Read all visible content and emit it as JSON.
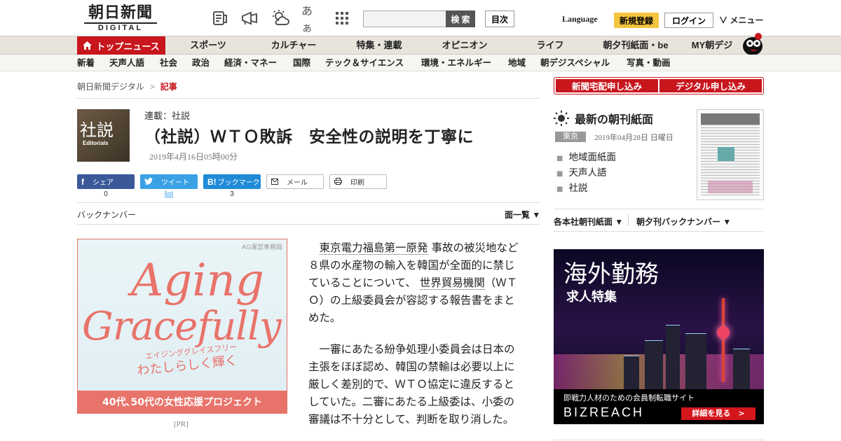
{
  "header": {
    "logo_line1": "朝日新聞",
    "logo_line2": "DIGITAL",
    "icons": [
      "newspaper-icon",
      "megaphone-icon",
      "weather-icon",
      "font-size-icon",
      "apps-grid-icon"
    ],
    "font_icon_text": "あぁ",
    "search_placeholder": "",
    "search_button": "検 索",
    "toc_button": "目次",
    "language": "Language",
    "register": "新規登録",
    "login": "ログイン",
    "menu": "∨ メニュー"
  },
  "nav1": {
    "home": "トップニュース",
    "items": [
      "スポーツ",
      "カルチャー",
      "特集・連載",
      "オピニオン",
      "ライフ",
      "朝夕刊紙面・be",
      "MY朝デジ"
    ]
  },
  "nav2": {
    "items": [
      "新着",
      "天声人語",
      "社会",
      "政治",
      "経済・マネー",
      "国際",
      "テック＆サイエンス",
      "環境・エネルギー",
      "地域",
      "朝デジスペシャル",
      "写真・動画"
    ]
  },
  "breadcrumb": {
    "root": "朝日新聞デジタル",
    "sep": ">",
    "current": "記事"
  },
  "article": {
    "thumb_title": "社説",
    "thumb_sub": "Editorials",
    "series": "連載：社説",
    "title": "（社説）ＷＴＯ敗訴　安全性の説明を丁寧に",
    "date": "2019年4月16日05時00分",
    "share": {
      "facebook_label": "シェア",
      "facebook_count": "0",
      "twitter_label": "ツイート",
      "twitter_count": "list",
      "hatena_label": "ブックマーク",
      "hatena_count": "3",
      "mail_label": "メール",
      "print_label": "印刷"
    },
    "backnumber": "バックナンバー",
    "list_label": "面一覧 ▼",
    "p1_link1": "東京電力福島第一原発",
    "p1_text1": " 事故の被災地など８県の水産物の輸入を韓国が全面的に禁じていることについて、 ",
    "p1_link2": "世界貿易機関",
    "p1_text2": "（ＷＴＯ）の上級委員会が容認する報告書をまとめた。",
    "p2": "一審にあたる紛争処理小委員会は日本の主張をほぼ認め、韓国の禁輸は必要以上に厳しく差別的で、ＷＴＯ協定に違反するとしていた。二審にあたる上級委は、小委の審議は不十分として、判断を取り消した。"
  },
  "ad_left": {
    "sponsor": "AG運営事務局",
    "line1": "Aging",
    "line2": "Gracefully",
    "kana": "エイジンググレイスフリー",
    "sub": "わたしらしく輝く",
    "band": "40代､50代の女性応援プロジェクト",
    "pr": "[PR]"
  },
  "sidebar": {
    "btn1": "新聞宅配申し込み",
    "btn2": "デジタル申し込み",
    "paper_title": "最新の朝刊紙面",
    "region": "東京",
    "paper_date": "2019年04月28日 日曜日",
    "links": [
      "地域面紙面",
      "天声人語",
      "社説"
    ],
    "dropdown1": "各本社朝刊紙面 ▼",
    "dropdown2": "朝夕刊バックナンバー ▼"
  },
  "ad_right": {
    "title": "海外勤務",
    "subtitle": "求人特集",
    "foot_text": "即戦力人材のための会員制転職サイト",
    "brand": "BIZREACH",
    "cta": "詳細を見る　>"
  },
  "colors": {
    "brand_red": "#c8161d",
    "register_yellow": "#f3c53e",
    "ad_coral": "#e8736a"
  }
}
